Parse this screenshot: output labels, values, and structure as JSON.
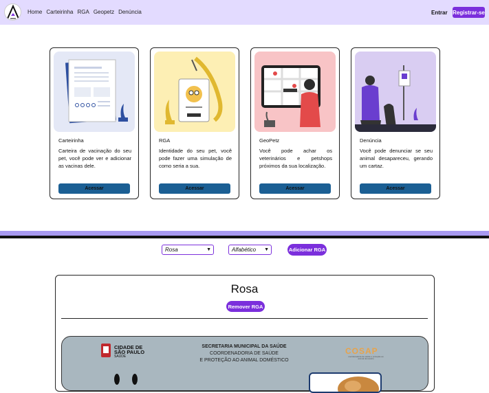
{
  "nav": {
    "links": [
      "Home",
      "Carteirinha",
      "RGA",
      "Geopetz",
      "Denúncia"
    ],
    "login": "Entrar",
    "register": "Registrar-se"
  },
  "cards": [
    {
      "title": "Carteirinha",
      "text": "Carteira de vacinação do seu pet, você pode ver e adicionar as vacinas dele.",
      "button": "Acessar",
      "bg": "#e4e8f6"
    },
    {
      "title": "RGA",
      "text": "Identidade do seu pet, você pode fazer uma simulação de como seria a sua.",
      "button": "Acessar",
      "bg": "#fdefb4"
    },
    {
      "title": "GeoPetz",
      "text": "Você pode achar os veterinários e petshops próximos da sua localização.",
      "button": "Acessar",
      "bg": "#f8c4c6"
    },
    {
      "title": "Denúncia",
      "text": "Você pode denunciar se seu animal desapareceu, gerando um cartaz.",
      "button": "Acessar",
      "bg": "#d9cdf2"
    }
  ],
  "filters": {
    "pet_select": "Rosa",
    "order_select": "Alfabético",
    "add_button": "Adicionar RGA"
  },
  "pet": {
    "name": "Rosa",
    "remove_button": "Remover RGA"
  },
  "rga": {
    "city_line1": "CIDADE DE",
    "city_line2": "SÃO PAULO",
    "city_line3": "SAÚDE",
    "sec_title": "SECRETARIA MUNICIPAL DA SAÚDE",
    "sec_line2": "COORDENADORIA DE SAÚDE",
    "sec_line3": "E PROTEÇÃO AO ANIMAL DOMÉSTICO",
    "cosap": "COSAP",
    "cosap_sub": "coordenadoria de saúde e proteção ao animal doméstico"
  },
  "colors": {
    "accent": "#7b2fdc",
    "nav_bg": "#e3dbff",
    "card_button": "#1b5f94"
  }
}
